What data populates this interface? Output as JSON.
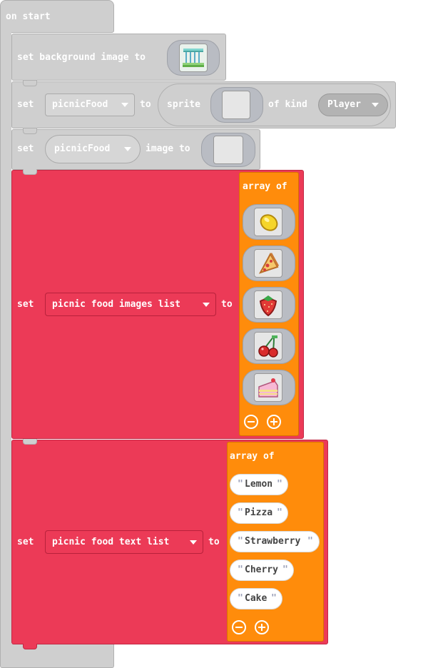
{
  "colors": {
    "events": "#cfcfcf",
    "arrays": "#ec3a57",
    "array_literal": "#ff8c0b",
    "image_slot": "#b9bcc3",
    "text_pill": "#ffffff"
  },
  "on_start": {
    "label": "on start"
  },
  "set_background": {
    "label": "set background image to",
    "image_icon": "picnic-pavilion-icon"
  },
  "set_sprite": {
    "set_label": "set",
    "variable": "picnicFood",
    "to_label": "to",
    "sprite_label": "sprite",
    "of_kind_label": "of kind",
    "kind": "Player"
  },
  "set_image": {
    "set_label": "set",
    "variable": "picnicFood",
    "image_to_label": "image to"
  },
  "images_list": {
    "set_label": "set",
    "variable": "picnic food images list",
    "to_label": "to",
    "array_label": "array of",
    "items": [
      {
        "icon": "lemon-icon"
      },
      {
        "icon": "pizza-slice-icon"
      },
      {
        "icon": "strawberry-icon"
      },
      {
        "icon": "cherries-icon"
      },
      {
        "icon": "cake-slice-icon"
      }
    ]
  },
  "text_list": {
    "set_label": "set",
    "variable": "picnic food text list",
    "to_label": "to",
    "array_label": "array of",
    "items": [
      "Lemon",
      "Pizza",
      "Strawberry",
      "Cherry",
      "Cake"
    ]
  }
}
